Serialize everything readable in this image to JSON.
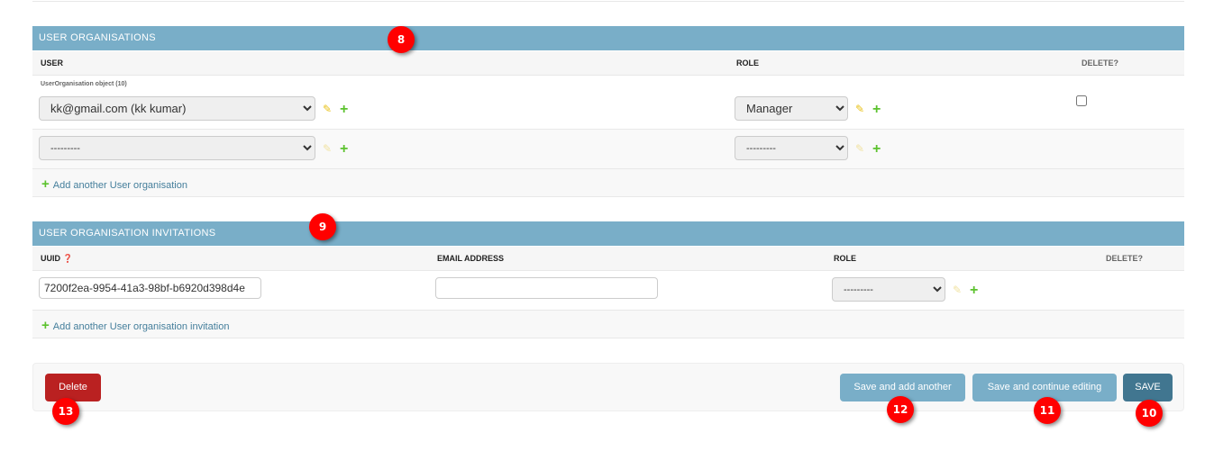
{
  "user_organisations": {
    "title": "USER ORGANISATIONS",
    "columns": {
      "user": "USER",
      "role": "ROLE",
      "delete": "DELETE?"
    },
    "rows": [
      {
        "object_label": "UserOrganisation object (10)",
        "user": "kk@gmail.com (kk kumar)",
        "role": "Manager",
        "delete_checked": false
      },
      {
        "user": "---------",
        "role": "---------"
      }
    ],
    "add_link": "Add another User organisation"
  },
  "invitations": {
    "title": "USER ORGANISATION INVITATIONS",
    "columns": {
      "uuid": "UUID",
      "email": "EMAIL ADDRESS",
      "role": "ROLE",
      "delete": "DELETE?"
    },
    "rows": [
      {
        "uuid": "7200f2ea-9954-41a3-98bf-b6920d398d4e",
        "email": "",
        "role": "---------"
      }
    ],
    "add_link": "Add another User organisation invitation"
  },
  "submit": {
    "delete": "Delete",
    "save_add": "Save and add another",
    "save_continue": "Save and continue editing",
    "save": "SAVE"
  },
  "badges": {
    "b8": "8",
    "b9": "9",
    "b10": "10",
    "b11": "11",
    "b12": "12",
    "b13": "13"
  },
  "colors": {
    "header": "#79aec8",
    "delete": "#ba2121",
    "save": "#417690",
    "secondary": "#79aec8",
    "badge": "#ff0000"
  }
}
